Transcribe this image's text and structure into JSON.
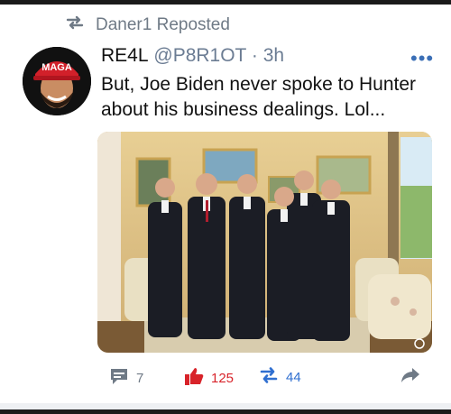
{
  "repost": {
    "icon": "repost-icon",
    "text": "Daner1 Reposted"
  },
  "post": {
    "display_name": "RE4L",
    "handle": "@P8R1OT",
    "separator": "·",
    "time": "3h",
    "text": "But, Joe Biden never spoke to Hunter about his business dealings. Lol...",
    "avatar_cap_text": "MAGA"
  },
  "actions": {
    "reply_count": "7",
    "like_count": "125",
    "repost_count": "44"
  },
  "colors": {
    "repost_blue": "#2f6fd0",
    "like_red": "#d8232a",
    "muted": "#6f7a86",
    "handle": "#6b7c93"
  }
}
